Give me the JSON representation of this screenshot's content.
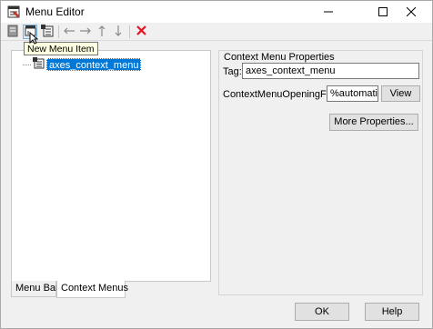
{
  "window": {
    "title": "Menu Editor"
  },
  "toolbar": {
    "buttons": [
      {
        "icon": "menu-bar-icon"
      },
      {
        "icon": "new-menu-item-icon"
      },
      {
        "icon": "new-context-menu-icon"
      },
      {
        "icon": "arrow-left-icon"
      },
      {
        "icon": "arrow-right-icon"
      },
      {
        "icon": "arrow-up-icon"
      },
      {
        "icon": "arrow-down-icon"
      },
      {
        "icon": "delete-icon"
      }
    ],
    "tooltip": "New Menu Item"
  },
  "tree": {
    "items": [
      {
        "label": "axes_context_menu",
        "selected": true
      }
    ]
  },
  "tabs": [
    {
      "label": "Menu Bar",
      "selected": false
    },
    {
      "label": "Context Menus",
      "selected": true
    }
  ],
  "properties": {
    "title": "Context Menu Properties",
    "tag_label": "Tag:",
    "tag_value": "axes_context_menu",
    "opening_fcn_label": "ContextMenuOpeningFcn:",
    "opening_fcn_value": "%automatic",
    "view_label": "View",
    "more_properties_label": "More Properties..."
  },
  "footer": {
    "ok_label": "OK",
    "help_label": "Help"
  },
  "colors": {
    "selection": "#0078d7",
    "delete_red": "#e81123",
    "tooltip_bg": "#ffffe1"
  }
}
